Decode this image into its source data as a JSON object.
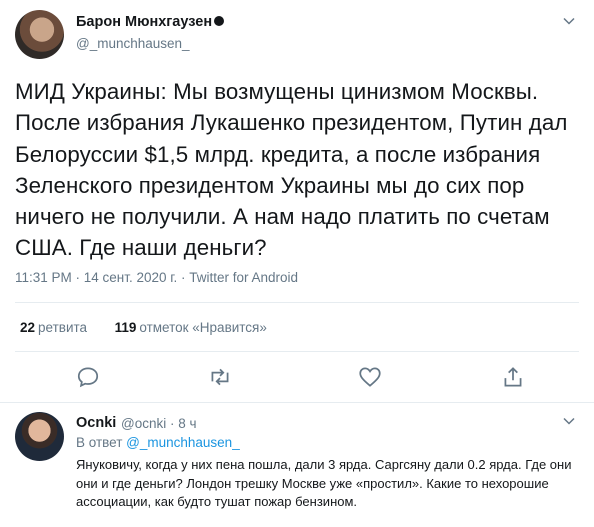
{
  "tweet": {
    "author_name": "Барон Мюнхгаузен",
    "author_handle": "@_munchhausen_",
    "text": "МИД Украины: Мы возмущены цинизмом Москвы. После избрания Лукашенко президентом, Путин дал Белоруссии $1,5 млрд. кредита, а после избрания Зеленского президентом Украины мы до сих пор ничего не получили. А нам надо платить по счетам США. Где наши деньги?",
    "meta": "11:31 PM · 14 сент. 2020 г. · Twitter for Android",
    "retweets_count": "22",
    "retweets_label": "ретвита",
    "likes_count": "119",
    "likes_label": "отметок «Нравится»"
  },
  "actions": {
    "reply_icon": "comment-icon",
    "retweet_icon": "retweet-icon",
    "like_icon": "heart-icon",
    "share_icon": "share-icon"
  },
  "reply": {
    "author_name": "Ocnki",
    "author_handle": "@ocnki · 8 ч",
    "in_reply_prefix": "В ответ ",
    "in_reply_handle": "@_munchhausen_",
    "text": "Януковичу, когда у них пена пошла, дали 3 ярда. Саргсяну дали 0.2 ярда. Где они они и где деньги? Лондон трешку Москве уже «простил». Какие то нехорошие ассоциации, как будто тушат пожар бензином."
  },
  "colors": {
    "text": "#14171a",
    "secondary": "#657786",
    "link": "#1b95e0",
    "divider": "#e6ecf0"
  }
}
